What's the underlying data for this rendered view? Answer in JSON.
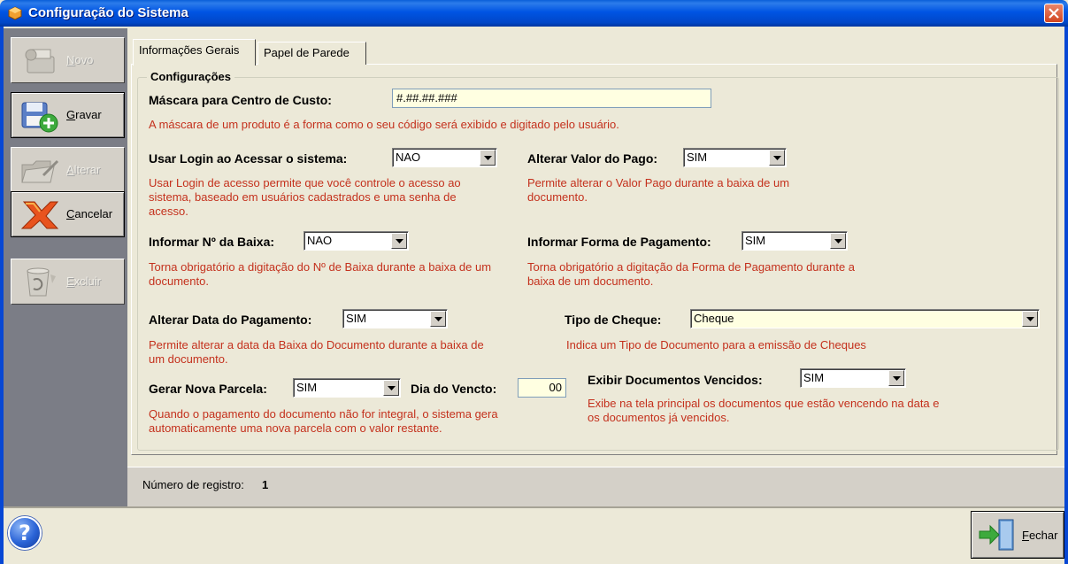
{
  "window": {
    "title": "Configuração do Sistema"
  },
  "toolbar": {
    "buttons": [
      {
        "label": "Novo",
        "accel": "N",
        "rest": "ovo",
        "enabled": false,
        "icon": "new-record-icon"
      },
      {
        "label": "Gravar",
        "accel": "G",
        "rest": "ravar",
        "enabled": true,
        "icon": "save-icon"
      },
      {
        "label": "Alterar",
        "accel": "A",
        "rest": "lterar",
        "enabled": false,
        "icon": "edit-folder-icon"
      },
      {
        "label": "Cancelar",
        "accel": "C",
        "rest": "ancelar",
        "enabled": true,
        "icon": "cancel-icon"
      },
      {
        "label": "Excluir",
        "accel": "E",
        "rest": "xcluir",
        "enabled": false,
        "icon": "recycle-bin-icon"
      }
    ]
  },
  "tabs": [
    {
      "label": "Informações Gerais",
      "active": true
    },
    {
      "label": "Papel de Parede",
      "active": false
    }
  ],
  "group": {
    "title": "Configurações"
  },
  "fields": {
    "mascara": {
      "label": "Máscara para Centro de Custo:",
      "value": "#.##.##.###",
      "desc": "A máscara de um produto é a forma como o seu código será exibido e digitado pelo usuário."
    },
    "usar_login": {
      "label": "Usar Login ao Acessar o sistema:",
      "value": "NAO",
      "desc": "Usar Login de acesso permite que você controle o acesso ao sistema, baseado em usuários cadastrados e uma senha de acesso."
    },
    "alterar_valor": {
      "label": "Alterar Valor do Pago:",
      "value": "SIM",
      "desc": "Permite alterar o Valor Pago durante a baixa de um documento."
    },
    "informar_baixa": {
      "label": "Informar Nº da Baixa:",
      "value": "NAO",
      "desc": "Torna obrigatório a digitação do Nº de Baixa durante a baixa de um documento."
    },
    "forma_pagamento": {
      "label": "Informar Forma de Pagamento:",
      "value": "SIM",
      "desc": "Torna obrigatório a digitação da Forma de Pagamento durante a baixa de um documento."
    },
    "alterar_data": {
      "label": "Alterar Data do Pagamento:",
      "value": "SIM",
      "desc": "Permite alterar a data da Baixa do Documento durante a baixa de um documento."
    },
    "tipo_cheque": {
      "label": "Tipo de Cheque:",
      "value": "Cheque",
      "desc": "Indica um Tipo de Documento para a emissão de Cheques"
    },
    "gerar_parcela": {
      "label": "Gerar Nova Parcela:",
      "value": "SIM",
      "desc": "Quando o pagamento do documento não for integral, o sistema gera automaticamente uma nova parcela com o valor restante."
    },
    "dia_vencto": {
      "label": "Dia do Vencto:",
      "value": "00"
    },
    "exibir_vencidos": {
      "label": "Exibir Documentos Vencidos:",
      "value": "SIM",
      "desc": "Exibe na tela principal os documentos que estão vencendo na data e os documentos já vencidos."
    }
  },
  "status": {
    "label": "Número de registro:",
    "value": "1"
  },
  "footer": {
    "help_label": "?",
    "close_accel": "F",
    "close_rest": "echar"
  },
  "colors": {
    "description_text": "#C4311D",
    "input_bg": "#FFFFE1",
    "title_bar": "#0054E3",
    "toolbar_bg": "#7B7D86"
  }
}
